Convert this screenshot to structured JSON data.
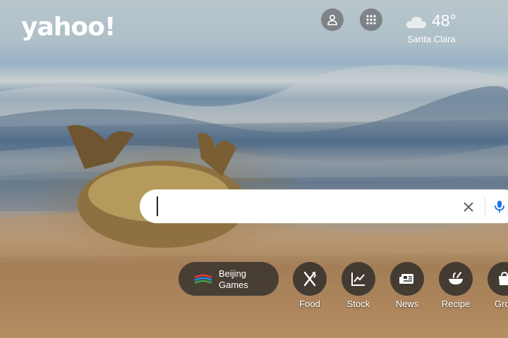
{
  "header": {
    "logo": "yahoo!",
    "account_icon": "person-icon",
    "apps_icon": "grid-icon"
  },
  "weather": {
    "icon": "cloud-icon",
    "temperature": "48°",
    "location": "Santa Clara"
  },
  "search": {
    "value": "",
    "placeholder": "",
    "clear_icon": "close-icon",
    "voice_icon": "mic-icon"
  },
  "promo": {
    "label_line1": "Beijing",
    "label_line2": "Games"
  },
  "shortcuts": [
    {
      "label": "Food",
      "icon": "fork-knife-icon"
    },
    {
      "label": "Stock",
      "icon": "chart-icon"
    },
    {
      "label": "News",
      "icon": "newspaper-icon"
    },
    {
      "label": "Recipe",
      "icon": "bowl-icon"
    },
    {
      "label": "Groc",
      "icon": "shopping-bag-icon"
    }
  ],
  "colors": {
    "accent": "#1a73e8"
  }
}
